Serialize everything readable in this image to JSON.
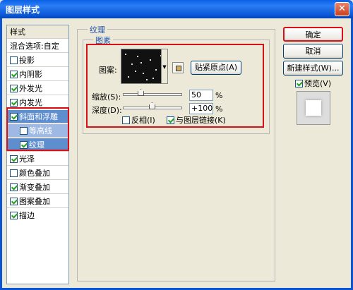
{
  "window": {
    "title": "图层样式",
    "close_icon": "✕"
  },
  "sidebar": {
    "header": "样式",
    "blend_options": "混合选项:自定",
    "items": [
      {
        "label": "投影",
        "checked": false
      },
      {
        "label": "内阴影",
        "checked": true
      },
      {
        "label": "外发光",
        "checked": true
      },
      {
        "label": "内发光",
        "checked": true
      },
      {
        "label": "斜面和浮雕",
        "checked": true
      },
      {
        "label": "等高线",
        "checked": false
      },
      {
        "label": "纹理",
        "checked": true
      },
      {
        "label": "光泽",
        "checked": true
      },
      {
        "label": "颜色叠加",
        "checked": false
      },
      {
        "label": "渐变叠加",
        "checked": true
      },
      {
        "label": "图案叠加",
        "checked": true
      },
      {
        "label": "描边",
        "checked": true
      }
    ]
  },
  "texture": {
    "section_title": "纹理",
    "group_title": "图素",
    "pattern_label": "图案:",
    "snap_origin_button": "贴紧原点(A)",
    "scale_label": "缩放(S):",
    "scale_value": "50",
    "scale_unit": "%",
    "scale_level": 50,
    "depth_label": "深度(D):",
    "depth_value": "+100",
    "depth_unit": "%",
    "depth_level": 100,
    "invert_label": "反相(I)",
    "invert_checked": false,
    "link_label": "与图层链接(K)",
    "link_checked": true
  },
  "actions": {
    "ok": "确定",
    "cancel": "取消",
    "new_style": "新建样式(W)...",
    "preview_label": "预览(V)",
    "preview_checked": true
  },
  "colors": {
    "highlight": "#d8101a",
    "selection": "#5f8ecf"
  }
}
